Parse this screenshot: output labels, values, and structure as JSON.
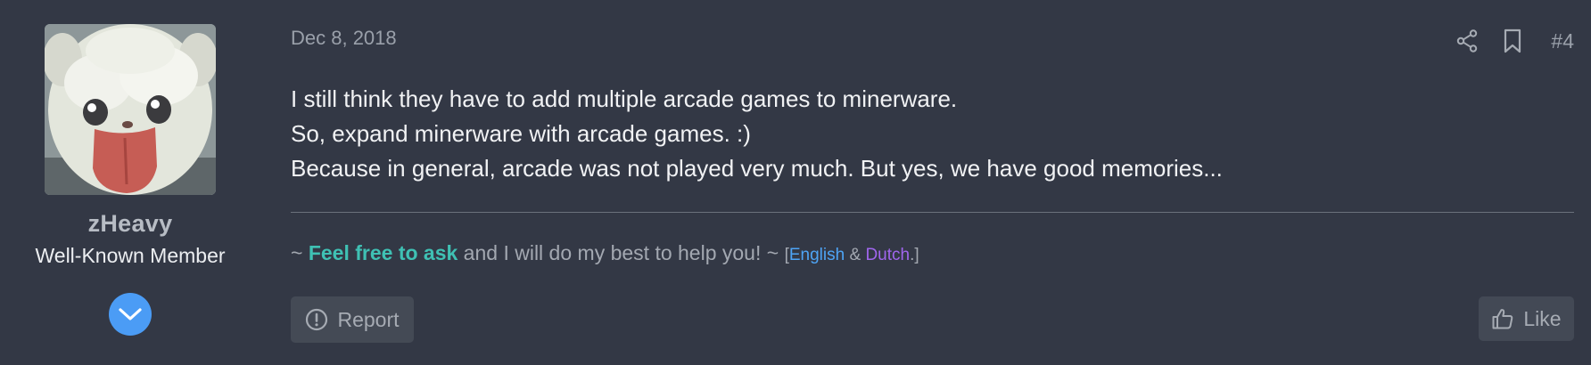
{
  "user": {
    "name": "zHeavy",
    "title": "Well-Known Member"
  },
  "post": {
    "date": "Dec 8, 2018",
    "number": "#4",
    "lines": [
      "I still think they have to add multiple arcade games to minerware.",
      "So, expand minerware with arcade games. :)",
      "Because in general, arcade was not played very much. But yes, we have good memories..."
    ]
  },
  "signature": {
    "prefix": "~ ",
    "link": "Feel free to ask",
    "middle": " and I will do my best to help you! ~ ",
    "bracket_open": "[",
    "lang_en": "English",
    "amp": " & ",
    "lang_nl": "Dutch",
    "bracket_close": ".]"
  },
  "actions": {
    "report_label": "Report",
    "like_label": "Like"
  },
  "colors": {
    "background": "#333845",
    "accent_blue": "#4b9cf5",
    "signature_link": "#3fc1b4",
    "english_link": "#4ea4f5",
    "dutch_link": "#a066ee"
  },
  "icons": {
    "share": "share-icon",
    "bookmark": "bookmark-icon",
    "expand": "chevron-down-icon",
    "report": "exclamation-circle-icon",
    "like": "thumbs-up-icon"
  }
}
